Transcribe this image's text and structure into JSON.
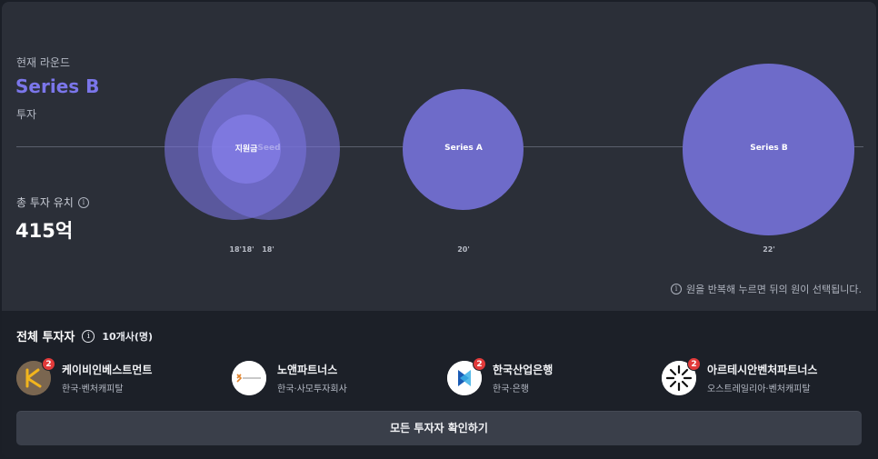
{
  "round": {
    "label": "현재 라운드",
    "value": "Series B",
    "type": "투자"
  },
  "total": {
    "label": "총 투자 유치",
    "value": "415억"
  },
  "chart": {
    "bubbles": [
      {
        "label": "",
        "year": ""
      },
      {
        "label": "Seed",
        "year": "18'"
      },
      {
        "label": "지원금",
        "year": "18'18'"
      },
      {
        "label": "Series A",
        "year": "20'"
      },
      {
        "label": "Series B",
        "year": "22'"
      }
    ],
    "hint": "원을 반복해 누르면 뒤의 원이 선택됩니다."
  },
  "investors": {
    "title": "전체 투자자",
    "count": "10개사(명)",
    "items": [
      {
        "name": "케이비인베스트먼트",
        "sub": "한국·벤처캐피탈",
        "badge": "2"
      },
      {
        "name": "노앤파트너스",
        "sub": "한국·사모투자회사",
        "badge": ""
      },
      {
        "name": "한국산업은행",
        "sub": "한국·은행",
        "badge": "2"
      },
      {
        "name": "아르테시안벤처파트너스",
        "sub": "오스트레일리아·벤처캐피탈",
        "badge": "2"
      }
    ]
  },
  "button": {
    "label": "모든 투자자 확인하기"
  },
  "colors": {
    "accent": "#7b76ea",
    "bubble": "#6e6bc9",
    "badge": "#e23a3a"
  }
}
